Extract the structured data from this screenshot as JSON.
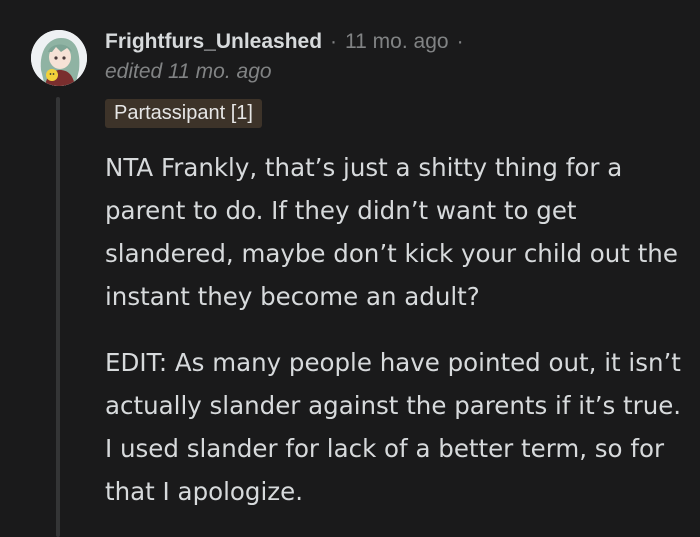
{
  "comment": {
    "username": "Frightfurs_Unleashed",
    "separator": "·",
    "timestamp": "11 mo. ago",
    "edited": "edited 11 mo. ago",
    "flair": "Partassipant [1]",
    "paragraphs": [
      "NTA Frankly, that’s just a shitty thing for a parent to do. If they didn’t want to get slandered, maybe don’t kick your child out the instant they become an adult?",
      "EDIT: As many people have pointed out, it isn’t actually slander against the parents if it’s true. I used slander for lack of a better term, so for that I apologize."
    ]
  },
  "colors": {
    "background": "#1a1a1b",
    "text": "#d7dadc",
    "muted": "#818384",
    "flair_bg": "#3d3329",
    "thread_line": "#343536"
  }
}
